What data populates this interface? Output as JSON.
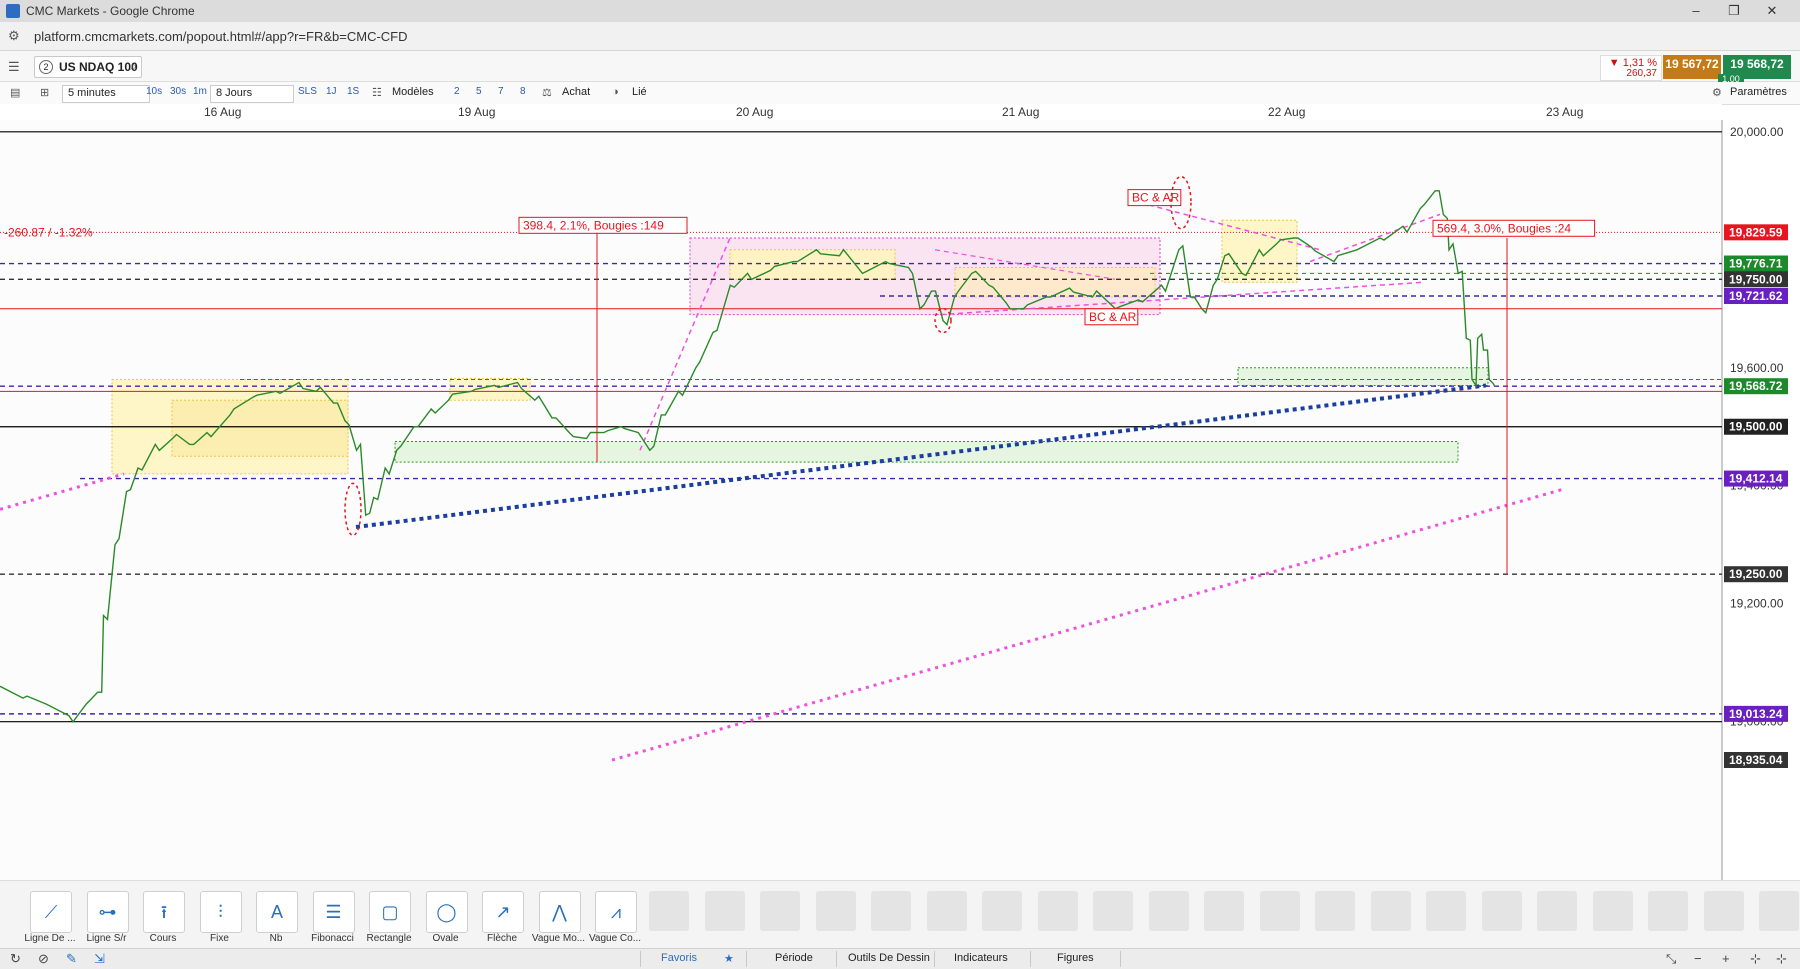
{
  "window": {
    "title": "CMC Markets - Google Chrome"
  },
  "browser": {
    "url": "platform.cmcmarkets.com/popout.html#/app?r=FR&b=CMC-CFD"
  },
  "instrument": {
    "number": "2",
    "name": "US NDAQ 100",
    "change_pct": "▼ 1,31 %",
    "change_pts": "260,37",
    "sell": "19 567,72",
    "buy": "19 568,72",
    "spread": "1,00"
  },
  "toolbar": {
    "interval": "5 minutes",
    "tf_10s": "10s",
    "tf_30s": "30s",
    "tf_1m": "1m",
    "range": "8 Jours",
    "sls": "SLS",
    "one_j": "1J",
    "one_s": "1S",
    "models": "Modèles",
    "n2": "2",
    "n5": "5",
    "n7": "7",
    "n8": "8",
    "buy": "Achat",
    "linked": "Lié",
    "settings": "Paramètres"
  },
  "dates": [
    "16 Aug",
    "19 Aug",
    "20 Aug",
    "21 Aug",
    "22 Aug",
    "23 Aug"
  ],
  "chart_data": {
    "type": "candlestick",
    "title": "",
    "xlabel": "",
    "ylabel": "",
    "ylim": [
      18935.04,
      20020
    ],
    "y_ticks": [
      "20,000.00",
      "19,600.00",
      "19,500.00",
      "19,400.00",
      "19,250.00",
      "19,200.00",
      "19,000.00"
    ],
    "axis_tags": [
      {
        "label": "19,829.59",
        "value": 19829.59,
        "color": "#e8141e"
      },
      {
        "label": "19,776.71",
        "value": 19776.71,
        "color": "#1b8a2a"
      },
      {
        "label": "19,750.00",
        "value": 19750.0,
        "color": "#333333"
      },
      {
        "label": "19,721.62",
        "value": 19721.62,
        "color": "#6a1fc0"
      },
      {
        "label": "19,568.72",
        "value": 19568.72,
        "color": "#1b8a2a"
      },
      {
        "label": "19,500.00",
        "value": 19500.0,
        "color": "#222222"
      },
      {
        "label": "19,412.14",
        "value": 19412.14,
        "color": "#6a1fc0"
      },
      {
        "label": "19,250.00",
        "value": 19250.0,
        "color": "#333333"
      },
      {
        "label": "19,013.24",
        "value": 19013.24,
        "color": "#6a1fc0"
      },
      {
        "label": "18,935.04",
        "value": 18935.04,
        "color": "#333333"
      }
    ],
    "price_path": [
      {
        "x": 0,
        "y": 19060
      },
      {
        "x": 20,
        "y": 19040
      },
      {
        "x": 40,
        "y": 19030
      },
      {
        "x": 60,
        "y": 19010
      },
      {
        "x": 75,
        "y": 19030
      },
      {
        "x": 85,
        "y": 19050
      },
      {
        "x": 90,
        "y": 19180
      },
      {
        "x": 100,
        "y": 19300
      },
      {
        "x": 110,
        "y": 19390
      },
      {
        "x": 120,
        "y": 19430
      },
      {
        "x": 135,
        "y": 19470
      },
      {
        "x": 150,
        "y": 19480
      },
      {
        "x": 165,
        "y": 19470
      },
      {
        "x": 180,
        "y": 19490
      },
      {
        "x": 200,
        "y": 19520
      },
      {
        "x": 220,
        "y": 19550
      },
      {
        "x": 240,
        "y": 19560
      },
      {
        "x": 260,
        "y": 19575
      },
      {
        "x": 275,
        "y": 19560
      },
      {
        "x": 290,
        "y": 19540
      },
      {
        "x": 300,
        "y": 19510
      },
      {
        "x": 310,
        "y": 19460
      },
      {
        "x": 318,
        "y": 19350
      },
      {
        "x": 325,
        "y": 19380
      },
      {
        "x": 335,
        "y": 19430
      },
      {
        "x": 345,
        "y": 19460
      },
      {
        "x": 360,
        "y": 19500
      },
      {
        "x": 375,
        "y": 19530
      },
      {
        "x": 390,
        "y": 19545
      },
      {
        "x": 410,
        "y": 19560
      },
      {
        "x": 430,
        "y": 19570
      },
      {
        "x": 450,
        "y": 19575
      },
      {
        "x": 465,
        "y": 19545
      },
      {
        "x": 480,
        "y": 19515
      },
      {
        "x": 495,
        "y": 19490
      },
      {
        "x": 510,
        "y": 19480
      },
      {
        "x": 525,
        "y": 19490
      },
      {
        "x": 540,
        "y": 19500
      },
      {
        "x": 555,
        "y": 19490
      },
      {
        "x": 565,
        "y": 19460
      },
      {
        "x": 575,
        "y": 19520
      },
      {
        "x": 590,
        "y": 19560
      },
      {
        "x": 605,
        "y": 19600
      },
      {
        "x": 620,
        "y": 19660
      },
      {
        "x": 635,
        "y": 19740
      },
      {
        "x": 650,
        "y": 19760
      },
      {
        "x": 670,
        "y": 19765
      },
      {
        "x": 690,
        "y": 19780
      },
      {
        "x": 710,
        "y": 19800
      },
      {
        "x": 730,
        "y": 19790
      },
      {
        "x": 750,
        "y": 19760
      },
      {
        "x": 770,
        "y": 19780
      },
      {
        "x": 790,
        "y": 19770
      },
      {
        "x": 800,
        "y": 19700
      },
      {
        "x": 810,
        "y": 19730
      },
      {
        "x": 820,
        "y": 19680
      },
      {
        "x": 830,
        "y": 19720
      },
      {
        "x": 845,
        "y": 19760
      },
      {
        "x": 860,
        "y": 19740
      },
      {
        "x": 875,
        "y": 19710
      },
      {
        "x": 890,
        "y": 19700
      },
      {
        "x": 910,
        "y": 19720
      },
      {
        "x": 930,
        "y": 19735
      },
      {
        "x": 950,
        "y": 19720
      },
      {
        "x": 970,
        "y": 19700
      },
      {
        "x": 990,
        "y": 19715
      },
      {
        "x": 1010,
        "y": 19740
      },
      {
        "x": 1025,
        "y": 19800
      },
      {
        "x": 1035,
        "y": 19720
      },
      {
        "x": 1045,
        "y": 19700
      },
      {
        "x": 1055,
        "y": 19740
      },
      {
        "x": 1065,
        "y": 19790
      },
      {
        "x": 1080,
        "y": 19760
      },
      {
        "x": 1095,
        "y": 19800
      },
      {
        "x": 1110,
        "y": 19810
      },
      {
        "x": 1125,
        "y": 19820
      },
      {
        "x": 1140,
        "y": 19805
      },
      {
        "x": 1160,
        "y": 19780
      },
      {
        "x": 1180,
        "y": 19800
      },
      {
        "x": 1200,
        "y": 19820
      },
      {
        "x": 1220,
        "y": 19840
      },
      {
        "x": 1235,
        "y": 19870
      },
      {
        "x": 1248,
        "y": 19900
      },
      {
        "x": 1255,
        "y": 19860
      },
      {
        "x": 1260,
        "y": 19800
      },
      {
        "x": 1268,
        "y": 19760
      },
      {
        "x": 1275,
        "y": 19650
      },
      {
        "x": 1280,
        "y": 19580
      },
      {
        "x": 1285,
        "y": 19650
      },
      {
        "x": 1290,
        "y": 19630
      },
      {
        "x": 1295,
        "y": 19580
      },
      {
        "x": 1300,
        "y": 19568
      }
    ],
    "annotations": {
      "change_label": "-260.87 / -1.32%",
      "measure1": "398.4, 2.1%, Bougies :149",
      "measure2": "569.4, 3.0%, Bougies :24",
      "bcar1": "BC & AR",
      "bcar2": "BC & AR"
    }
  },
  "draw_tools": [
    {
      "label": "Ligne De ...",
      "icon": "line-icon",
      "glyph": "⟋"
    },
    {
      "label": "Ligne S/r",
      "icon": "hline-icon",
      "glyph": "⊶"
    },
    {
      "label": "Cours",
      "icon": "price-icon",
      "glyph": "⭱"
    },
    {
      "label": "Fixe",
      "icon": "fixed-icon",
      "glyph": "⫶"
    },
    {
      "label": "Nb",
      "icon": "text-icon",
      "glyph": "A"
    },
    {
      "label": "Fibonacci",
      "icon": "fibonacci-icon",
      "glyph": "☰"
    },
    {
      "label": "Rectangle",
      "icon": "rectangle-icon",
      "glyph": "▢"
    },
    {
      "label": "Ovale",
      "icon": "oval-icon",
      "glyph": "◯"
    },
    {
      "label": "Flèche",
      "icon": "arrow-icon",
      "glyph": "↗"
    },
    {
      "label": "Vague Mo...",
      "icon": "wave-icon",
      "glyph": "⋀"
    },
    {
      "label": "Vague Co...",
      "icon": "wave-co-icon",
      "glyph": "⩘"
    }
  ],
  "bottom_tabs": {
    "favorites": "Favoris",
    "period": "Période",
    "drawing_tools": "Outils De Dessin",
    "indicators": "Indicateurs",
    "figures": "Figures"
  }
}
